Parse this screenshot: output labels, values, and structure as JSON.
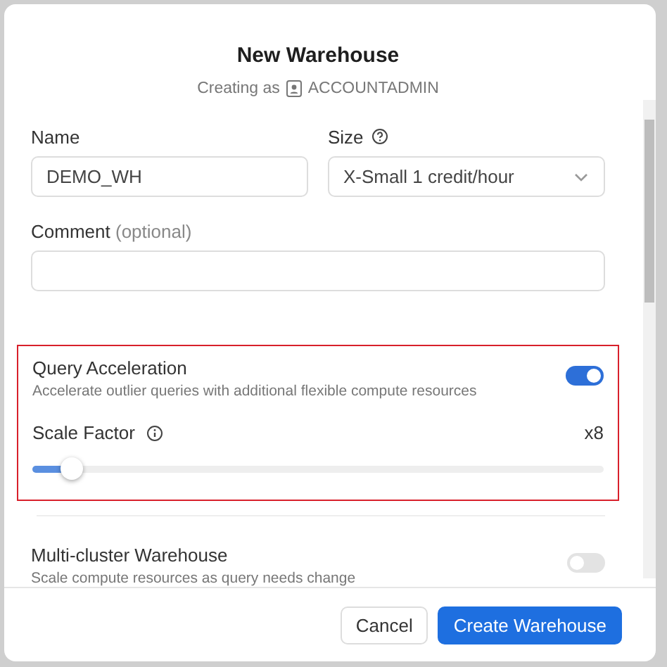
{
  "dialog": {
    "title": "New Warehouse",
    "subtitle_prefix": "Creating as",
    "role": "ACCOUNTADMIN"
  },
  "fields": [
    {
      "label": "Name",
      "value": "DEMO_WH",
      "kind": "text"
    },
    {
      "label": "Size",
      "value": "X-Small 1 credit/hour",
      "kind": "select"
    }
  ],
  "comment": {
    "label": "Comment",
    "hint": "(optional)"
  },
  "query_acceleration": {
    "title": "Query Acceleration",
    "description": "Accelerate outlier queries with additional flexible compute resources",
    "on": true,
    "highlighted": true,
    "scale_factor": {
      "label": "Scale Factor",
      "reading": "x8",
      "level": 0.07
    }
  },
  "multi_cluster": {
    "title": "Multi-cluster Warehouse",
    "description": "Scale compute resources as query needs change",
    "on": false
  },
  "buttons": [
    {
      "label": "Cancel",
      "kind": "secondary"
    },
    {
      "label": "Create Warehouse",
      "kind": "primary"
    }
  ]
}
